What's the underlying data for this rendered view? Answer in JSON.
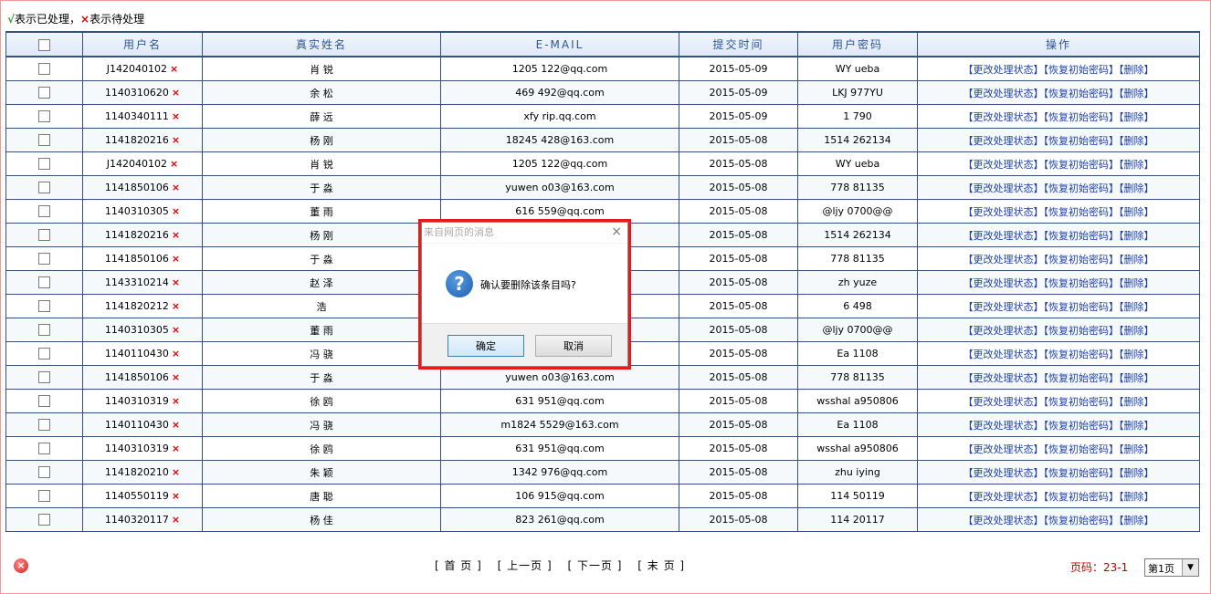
{
  "legend": {
    "check": "√",
    "done_text": "表示已处理，",
    "x": "×",
    "pending_text": "表示待处理"
  },
  "table": {
    "headers": [
      "用户名",
      "真实姓名",
      "E-MAIL",
      "提交时间",
      "用户密码",
      "操作"
    ],
    "actions": {
      "change_status": "【更改处理状态】",
      "reset_password": "【恢复初始密码】",
      "delete": "【删除】"
    },
    "rows": [
      {
        "username": "J142040102",
        "name": "肖  锐",
        "email": "1205 122@qq.com",
        "time": "2015-05-09",
        "password": "WY ueba"
      },
      {
        "username": "1140310620",
        "name": "余  松",
        "email": "469 492@qq.com",
        "time": "2015-05-09",
        "password": "LKJ 977YU"
      },
      {
        "username": "1140340111",
        "name": "薛  远",
        "email": "xfy rip.qq.com",
        "time": "2015-05-09",
        "password": "1 790"
      },
      {
        "username": "1141820216",
        "name": "杨  刚",
        "email": "18245 428@163.com",
        "time": "2015-05-08",
        "password": "1514 262134"
      },
      {
        "username": "J142040102",
        "name": "肖  锐",
        "email": "1205 122@qq.com",
        "time": "2015-05-08",
        "password": "WY ueba"
      },
      {
        "username": "1141850106",
        "name": "于  淼",
        "email": "yuwen o03@163.com",
        "time": "2015-05-08",
        "password": "778 81135"
      },
      {
        "username": "1140310305",
        "name": "董  雨",
        "email": "616 559@qq.com",
        "time": "2015-05-08",
        "password": "@ljy 0700@@"
      },
      {
        "username": "1141820216",
        "name": "杨  刚",
        "email": "",
        "time": "2015-05-08",
        "password": "1514 262134"
      },
      {
        "username": "1141850106",
        "name": "于  淼",
        "email": "",
        "time": "2015-05-08",
        "password": "778 81135"
      },
      {
        "username": "1143310214",
        "name": "赵  泽",
        "email": "",
        "time": "2015-05-08",
        "password": "zh yuze"
      },
      {
        "username": "1141820212",
        "name": "  浩",
        "email": "",
        "time": "2015-05-08",
        "password": "6 498"
      },
      {
        "username": "1140310305",
        "name": "董  雨",
        "email": "",
        "time": "2015-05-08",
        "password": "@ljy 0700@@"
      },
      {
        "username": "1140110430",
        "name": "冯  骁",
        "email": "",
        "time": "2015-05-08",
        "password": "Ea 1108"
      },
      {
        "username": "1141850106",
        "name": "于  淼",
        "email": "yuwen o03@163.com",
        "time": "2015-05-08",
        "password": "778 81135"
      },
      {
        "username": "1140310319",
        "name": "徐  鸥",
        "email": "631 951@qq.com",
        "time": "2015-05-08",
        "password": "wsshal a950806"
      },
      {
        "username": "1140110430",
        "name": "冯  骁",
        "email": "m1824 5529@163.com",
        "time": "2015-05-08",
        "password": "Ea 1108"
      },
      {
        "username": "1140310319",
        "name": "徐  鸥",
        "email": "631 951@qq.com",
        "time": "2015-05-08",
        "password": "wsshal a950806"
      },
      {
        "username": "1141820210",
        "name": "朱  颖",
        "email": "1342 976@qq.com",
        "time": "2015-05-08",
        "password": "zhu iying"
      },
      {
        "username": "1140550119",
        "name": "唐  聪",
        "email": "106 915@qq.com",
        "time": "2015-05-08",
        "password": "114 50119"
      },
      {
        "username": "1140320117",
        "name": "杨  佳",
        "email": "823 261@qq.com",
        "time": "2015-05-08",
        "password": "114 20117"
      }
    ]
  },
  "pager": {
    "first": "[ 首 页 ]",
    "prev": "[ 上一页 ]",
    "next": "[ 下一页 ]",
    "last": "[ 末 页 ]",
    "page_info": "页码：23-1",
    "select_value": "第1页"
  },
  "dialog": {
    "title": "来自网页的消息",
    "message": "确认要删除该条目吗?",
    "ok": "确定",
    "cancel": "取消",
    "close": "×"
  }
}
